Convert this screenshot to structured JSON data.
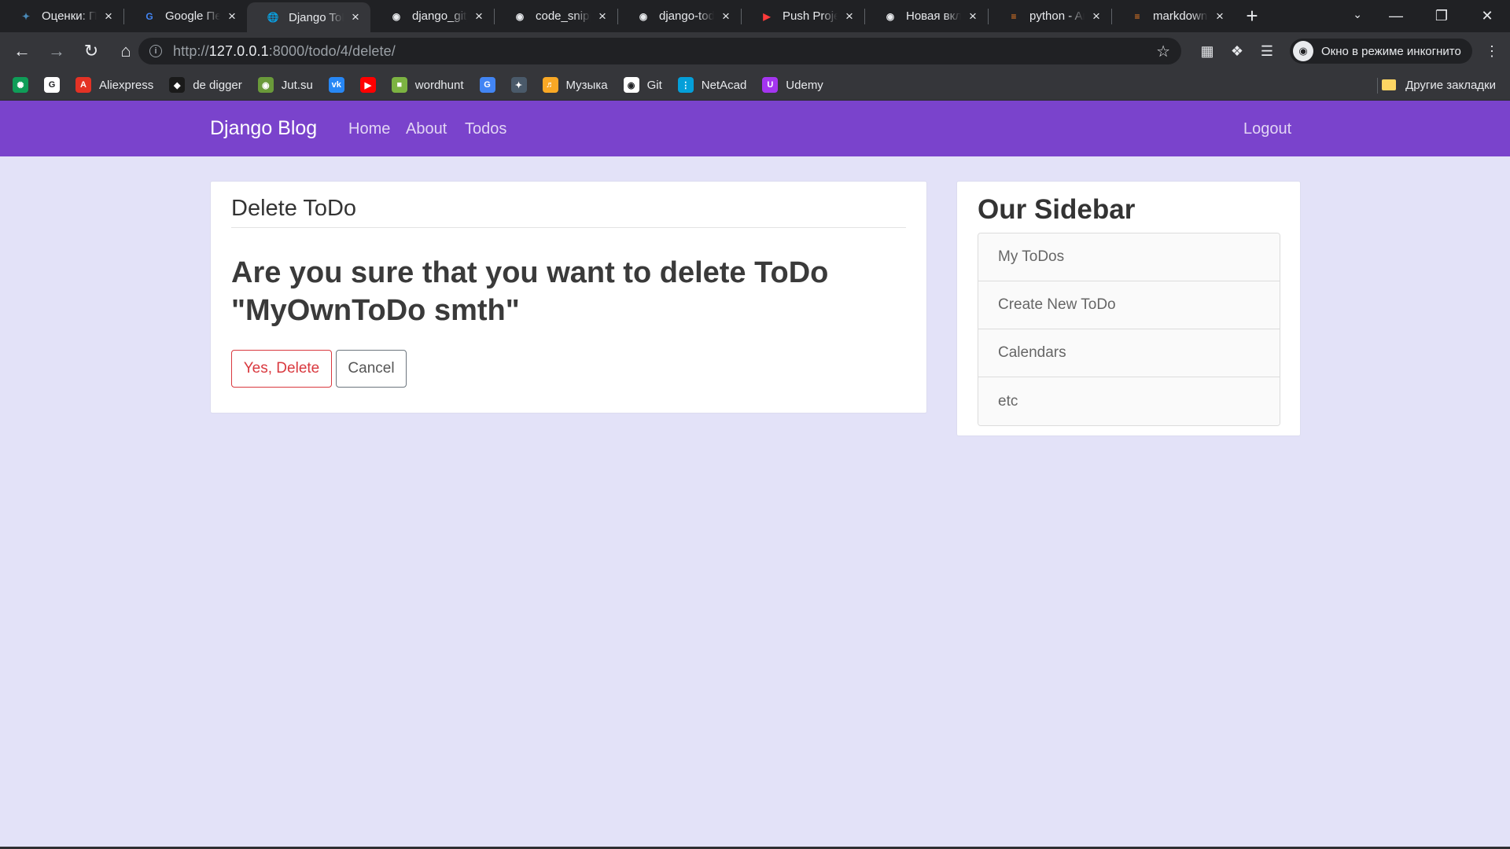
{
  "browser": {
    "tabs": [
      {
        "title": "Оценки: Пр",
        "favicon": "generic-site-icon",
        "active": false
      },
      {
        "title": "Google Пер",
        "favicon": "google-translate-icon",
        "active": false
      },
      {
        "title": "Django ToD",
        "favicon": "globe-icon",
        "active": true
      },
      {
        "title": "django_git_",
        "favicon": "github-icon",
        "active": false
      },
      {
        "title": "code_snipp",
        "favicon": "github-icon",
        "active": false
      },
      {
        "title": "django-tod",
        "favicon": "github-icon",
        "active": false
      },
      {
        "title": "Push Projec",
        "favicon": "youtube-icon",
        "active": false
      },
      {
        "title": "Новая вкла",
        "favicon": "incognito-icon",
        "active": false
      },
      {
        "title": "python - Ar",
        "favicon": "stackoverflow-icon",
        "active": false
      },
      {
        "title": "markdown",
        "favicon": "stackoverflow-icon",
        "active": false
      }
    ],
    "url_prefix": "http://",
    "url_host": "127.0.0.1",
    "url_rest": ":8000/todo/4/delete/",
    "incognito_label": "Окно в режиме инкогнито",
    "bookmarks": [
      {
        "label": "",
        "icon": "custom-app-icon",
        "color": "#0f9d58"
      },
      {
        "label": "",
        "icon": "google-icon",
        "color": "#ffffff"
      },
      {
        "label": "Aliexpress",
        "icon": "aliexpress-icon",
        "color": "#e43225"
      },
      {
        "label": "de digger",
        "icon": "dedigger-icon",
        "color": "#1a1a1a"
      },
      {
        "label": "Jut.su",
        "icon": "jutsu-icon",
        "color": "#6a9a3a"
      },
      {
        "label": "",
        "icon": "vk-icon",
        "color": "#2787f5"
      },
      {
        "label": "",
        "icon": "youtube-icon",
        "color": "#ff0000"
      },
      {
        "label": "wordhunt",
        "icon": "wordhunt-icon",
        "color": "#7cb342"
      },
      {
        "label": "",
        "icon": "google-translate-icon",
        "color": "#4285f4"
      },
      {
        "label": "",
        "icon": "generic-site-icon",
        "color": "#4a5a6a"
      },
      {
        "label": "Музыка",
        "icon": "music-icon",
        "color": "#f9a825"
      },
      {
        "label": "Git",
        "icon": "github-icon",
        "color": "#ffffff"
      },
      {
        "label": "NetAcad",
        "icon": "cisco-icon",
        "color": "#049fd9"
      },
      {
        "label": "Udemy",
        "icon": "udemy-icon",
        "color": "#a435f0"
      }
    ],
    "other_bookmarks": "Другие закладки"
  },
  "navbar": {
    "brand": "Django Blog",
    "links": [
      "Home",
      "About",
      "Todos"
    ],
    "logout": "Logout",
    "bg": "#7a43cc"
  },
  "main": {
    "title": "Delete ToDo",
    "question": "Are you sure that you want to delete ToDo \"MyOwnToDo smth\"",
    "delete_label": "Yes, Delete",
    "cancel_label": "Cancel"
  },
  "sidebar": {
    "title": "Our Sidebar",
    "items": [
      "My ToDos",
      "Create New ToDo",
      "Calendars",
      "etc"
    ]
  },
  "colors": {
    "page_bg": "#e3e2f8",
    "danger": "#d9383e"
  }
}
